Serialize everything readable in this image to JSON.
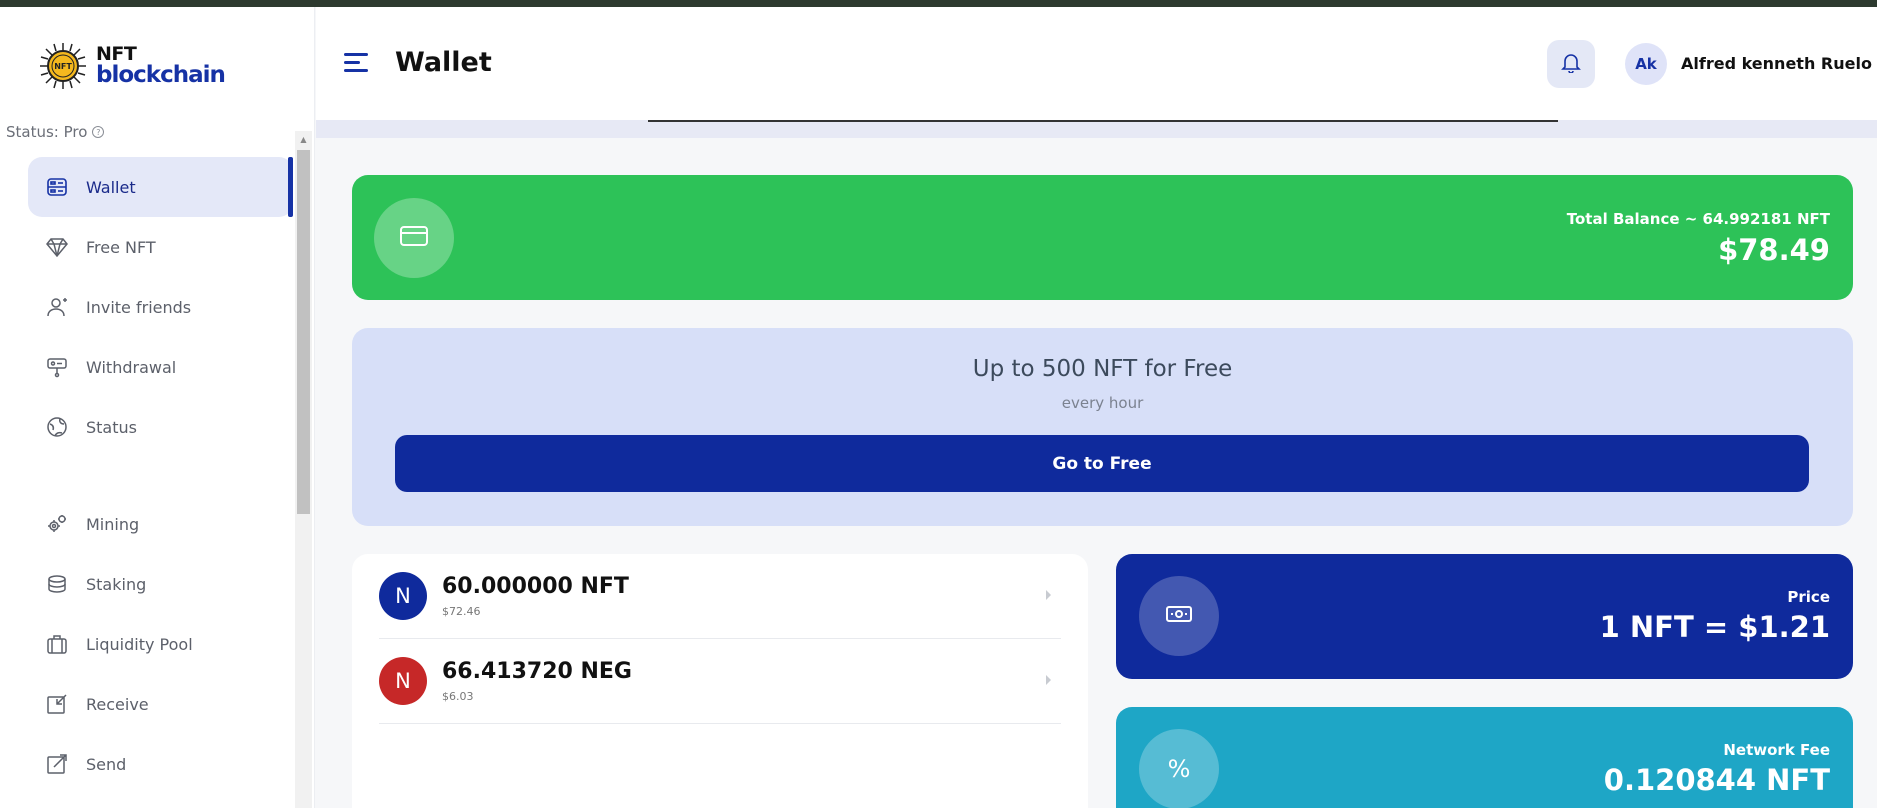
{
  "brand": {
    "logo_top": "NFT",
    "logo_bottom": "blockchain",
    "logo_mark_text": "NFT"
  },
  "sidebar": {
    "status": "Status: Pro",
    "items": [
      {
        "label": "Wallet",
        "icon": "wallet-icon",
        "active": true
      },
      {
        "label": "Free NFT",
        "icon": "diamond-icon"
      },
      {
        "label": "Invite friends",
        "icon": "invite-user-icon"
      },
      {
        "label": "Withdrawal",
        "icon": "withdrawal-icon"
      },
      {
        "label": "Status",
        "icon": "status-globe-icon"
      },
      {
        "label": "Mining",
        "icon": "gears-icon"
      },
      {
        "label": "Staking",
        "icon": "coins-stack-icon"
      },
      {
        "label": "Liquidity Pool",
        "icon": "briefcase-icon"
      },
      {
        "label": "Receive",
        "icon": "receive-icon"
      },
      {
        "label": "Send",
        "icon": "send-icon"
      }
    ]
  },
  "header": {
    "title": "Wallet",
    "avatar_initials": "Ak",
    "username": "Alfred kenneth Ruelo"
  },
  "balance": {
    "label": "Total Balance ~ 64.992181 NFT",
    "amount": "$78.49"
  },
  "promo": {
    "title": "Up to 500 NFT for Free",
    "subtitle": "every hour",
    "button": "Go to Free"
  },
  "assets": [
    {
      "letter": "N",
      "amount": "60.000000 NFT",
      "usd": "$72.46",
      "color": "#0f2a9c"
    },
    {
      "letter": "N",
      "amount": "66.413720 NEG",
      "usd": "$6.03",
      "color": "#c62828"
    }
  ],
  "price": {
    "label": "Price",
    "value": "1 NFT = $1.21"
  },
  "fee": {
    "label": "Network Fee",
    "value": "0.120844 NFT",
    "symbol": "%"
  },
  "colors": {
    "accent": "#1632a5",
    "balance_green": "#2dc258",
    "price_blue": "#0f2a9c",
    "fee_teal": "#1ea6c6"
  }
}
